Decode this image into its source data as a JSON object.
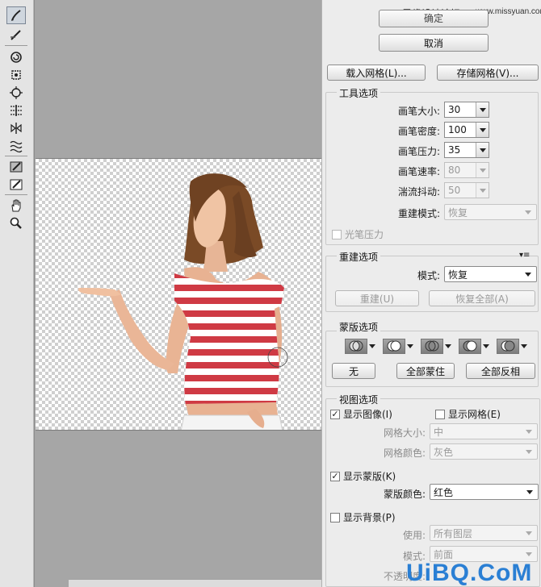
{
  "watermark_top": {
    "text": "思缘设计论坛",
    "url": "www.missyuan.com"
  },
  "buttons": {
    "ok": "确定",
    "cancel": "取消",
    "load_mesh": "载入网格(L)...",
    "save_mesh": "存储网格(V)..."
  },
  "tool_options": {
    "title": "工具选项",
    "brush_size": {
      "label": "画笔大小:",
      "value": "30"
    },
    "brush_density": {
      "label": "画笔密度:",
      "value": "100"
    },
    "brush_pressure": {
      "label": "画笔压力:",
      "value": "35"
    },
    "brush_rate": {
      "label": "画笔速率:",
      "value": "80"
    },
    "turbulent_jitter": {
      "label": "湍流抖动:",
      "value": "50"
    },
    "reconstruct_mode": {
      "label": "重建模式:",
      "value": "恢复"
    },
    "stylus_pressure": "光笔压力"
  },
  "reconstruct_options": {
    "title": "重建选项",
    "mode_label": "模式:",
    "mode_value": "恢复",
    "reconstruct": "重建(U)",
    "restore_all": "恢复全部(A)"
  },
  "mask_options": {
    "title": "蒙版选项",
    "none": "无",
    "mask_all": "全部蒙住",
    "invert_all": "全部反相"
  },
  "view_options": {
    "title": "视图选项",
    "show_image": {
      "label": "显示图像(I)",
      "checked": true
    },
    "show_mesh": {
      "label": "显示网格(E)",
      "checked": false
    },
    "mesh_size": {
      "label": "网格大小:",
      "value": "中"
    },
    "mesh_color": {
      "label": "网格颜色:",
      "value": "灰色"
    },
    "show_mask": {
      "label": "显示蒙版(K)",
      "checked": true
    },
    "mask_color": {
      "label": "蒙版颜色:",
      "value": "红色"
    },
    "show_backdrop": {
      "label": "显示背景(P)",
      "checked": false
    },
    "use": {
      "label": "使用:",
      "value": "所有图层"
    },
    "mode": {
      "label": "模式:",
      "value": "前面"
    },
    "opacity": {
      "label": "不透明度:"
    }
  },
  "watermark_bottom": "UiBQ.CoM"
}
